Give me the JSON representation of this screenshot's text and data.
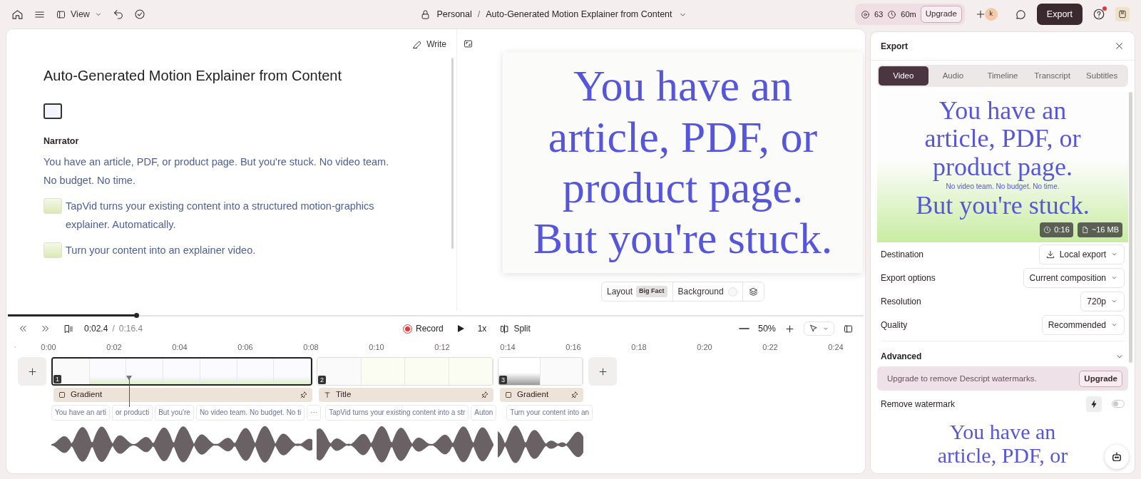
{
  "top_bar": {
    "view_label": "View",
    "workspace": "Personal",
    "separator": "/",
    "project_title": "Auto-Generated Motion Explainer from Content",
    "credits": "63",
    "minutes": "60m",
    "upgrade_label": "Upgrade",
    "avatar_initial": "k",
    "export_label": "Export",
    "has_notification": true
  },
  "editor": {
    "write_label": "Write",
    "title": "Auto-Generated Motion Explainer from Content",
    "speaker": "Narrator",
    "paragraphs": [
      {
        "text": "You have an article, PDF, or product page. But you're stuck. No video team. No budget. No time.",
        "thumbnail": false
      },
      {
        "text": "TapVid turns your existing content into a structured motion-graphics explainer. Automatically.",
        "thumbnail": true
      },
      {
        "text": "Turn your content into an explainer video.",
        "thumbnail": true
      }
    ]
  },
  "preview": {
    "slide_lines": [
      "You have an",
      "article, PDF, or",
      "product page.",
      "But you're stuck."
    ],
    "layout_label": "Layout",
    "layout_value": "Big Fact",
    "background_label": "Background"
  },
  "transport": {
    "current_time": "0:02.4",
    "separator": "/",
    "total_time": "0:16.4",
    "record_label": "Record",
    "speed": "1x",
    "split_label": "Split",
    "zoom": "50%",
    "progress": {
      "level": 0.15
    }
  },
  "timeline": {
    "ruler": [
      "0:00",
      "0:02",
      "0:04",
      "0:06",
      "0:08",
      "0:10",
      "0:12",
      "0:14",
      "0:16",
      "0:18",
      "0:20",
      "0:22",
      "0:24"
    ],
    "clips": [
      {
        "number": "1",
        "selected": true
      },
      {
        "number": "2",
        "selected": false
      },
      {
        "number": "3",
        "selected": false
      }
    ],
    "layers": [
      {
        "kind": "gradient",
        "label": "Gradient"
      },
      {
        "kind": "title",
        "label": "Title"
      },
      {
        "kind": "gradient",
        "label": "Gradient"
      }
    ],
    "captions": [
      {
        "chips": [
          "You have an arti",
          "or producti",
          "But you're",
          "No video team. No budget. No ti",
          "···"
        ]
      },
      {
        "chips": [
          "TapVid turns your existing content into a str",
          "Auton"
        ]
      },
      {
        "chips": [
          "Turn your content into an"
        ]
      }
    ]
  },
  "export_panel": {
    "title": "Export",
    "tabs": [
      {
        "label": "Video",
        "selected": true
      },
      {
        "label": "Audio",
        "selected": false
      },
      {
        "label": "Timeline",
        "selected": false
      },
      {
        "label": "Transcript",
        "selected": false
      },
      {
        "label": "Subtitles",
        "selected": false
      }
    ],
    "preview_lines": [
      "You have an",
      "article, PDF, or",
      "product page.",
      "But you're stuck."
    ],
    "preview_overlay": "No video team. No budget. No time.",
    "duration": "0:16",
    "size": "~16 MB",
    "settings": [
      {
        "kind": "destination",
        "label": "Destination",
        "value": "Local export"
      },
      {
        "kind": "select",
        "label": "Export options",
        "value": "Current composition"
      },
      {
        "kind": "select",
        "label": "Resolution",
        "value": "720p"
      },
      {
        "kind": "select",
        "label": "Quality",
        "value": "Recommended"
      }
    ],
    "advanced_label": "Advanced",
    "advanced_expanded": true,
    "banner_text": "Upgrade to remove Descript watermarks.",
    "banner_button": "Upgrade",
    "watermark_label": "Remove watermark",
    "watermark_on": false,
    "next_preview_lines": [
      "You have an",
      "article, PDF, or"
    ]
  }
}
